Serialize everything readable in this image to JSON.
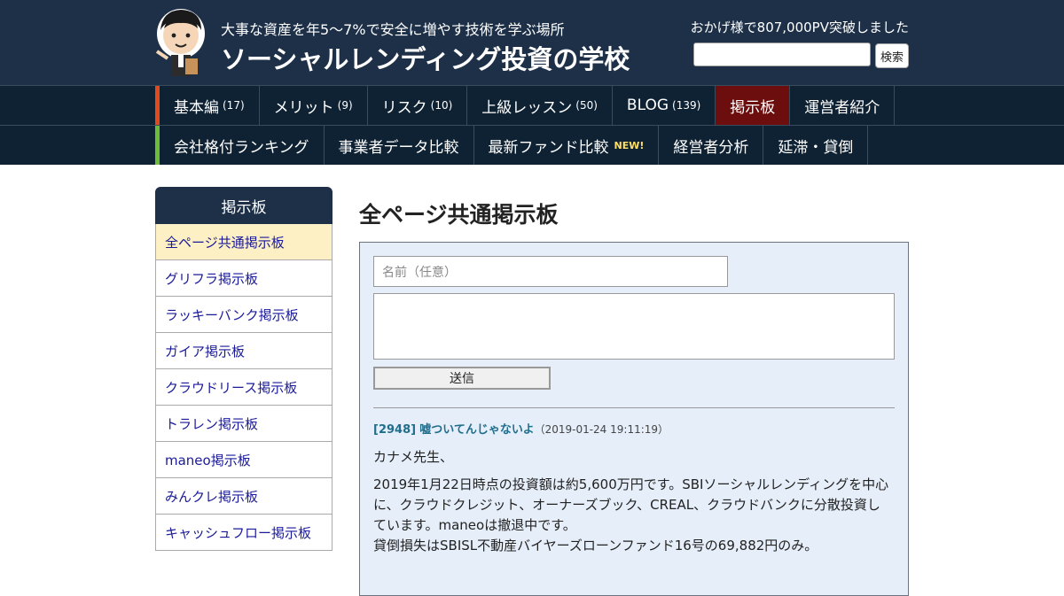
{
  "header": {
    "tagline": "大事な資産を年5～7%で安全に増やす技術を学ぶ場所",
    "site_title": "ソーシャルレンディング投資の学校",
    "pv_notice": "おかげ様で807,000PV突破しました",
    "search_button": "検索"
  },
  "nav_primary": [
    {
      "label": "基本編",
      "count": "(17)"
    },
    {
      "label": "メリット",
      "count": "(9)"
    },
    {
      "label": "リスク",
      "count": "(10)"
    },
    {
      "label": "上級レッスン",
      "count": "(50)"
    },
    {
      "label": "BLOG",
      "count": "(139)"
    },
    {
      "label": "掲示板",
      "count": ""
    },
    {
      "label": "運営者紹介",
      "count": ""
    }
  ],
  "nav_secondary": [
    {
      "label": "会社格付ランキング",
      "badge": ""
    },
    {
      "label": "事業者データ比較",
      "badge": ""
    },
    {
      "label": "最新ファンド比較",
      "badge": "NEW!"
    },
    {
      "label": "経営者分析",
      "badge": ""
    },
    {
      "label": "延滞・貸倒",
      "badge": ""
    }
  ],
  "sidebar": {
    "heading": "掲示板",
    "items": [
      "全ページ共通掲示板",
      "グリフラ掲示板",
      "ラッキーバンク掲示板",
      "ガイア掲示板",
      "クラウドリース掲示板",
      "トラレン掲示板",
      "maneo掲示板",
      "みんクレ掲示板",
      "キャッシュフロー掲示板"
    ]
  },
  "main": {
    "title": "全ページ共通掲示板",
    "form": {
      "name_placeholder": "名前（任意）",
      "submit_label": "送信"
    },
    "post": {
      "id": "[2948]",
      "title": "嘘ついてんじゃないよ",
      "date": "（2019-01-24 19:11:19）",
      "greeting": "カナメ先生、",
      "body_lines": [
        "2019年1月22日時点の投資額は約5,600万円です。SBIソーシャルレンディングを中心",
        "に、クラウドクレジット、オーナーズブック、CREAL、クラウドバンクに分散投資し",
        "ています。maneoは撤退中です。",
        "貸倒損失はSBISL不動産バイヤーズローンファンド16号の69,882円のみ。"
      ]
    }
  },
  "colors": {
    "header_bg": "#1d3048",
    "nav_bg": "#0f2233",
    "nav_active_bg": "#6d0e0e",
    "nav1_accent": "#e04a1c",
    "nav2_accent": "#6cbc3a",
    "board_bg": "#e6eef9",
    "link": "#1a1a9a",
    "post_title": "#1f6e8c",
    "sidebar_active_bg": "#fdf0c4"
  }
}
